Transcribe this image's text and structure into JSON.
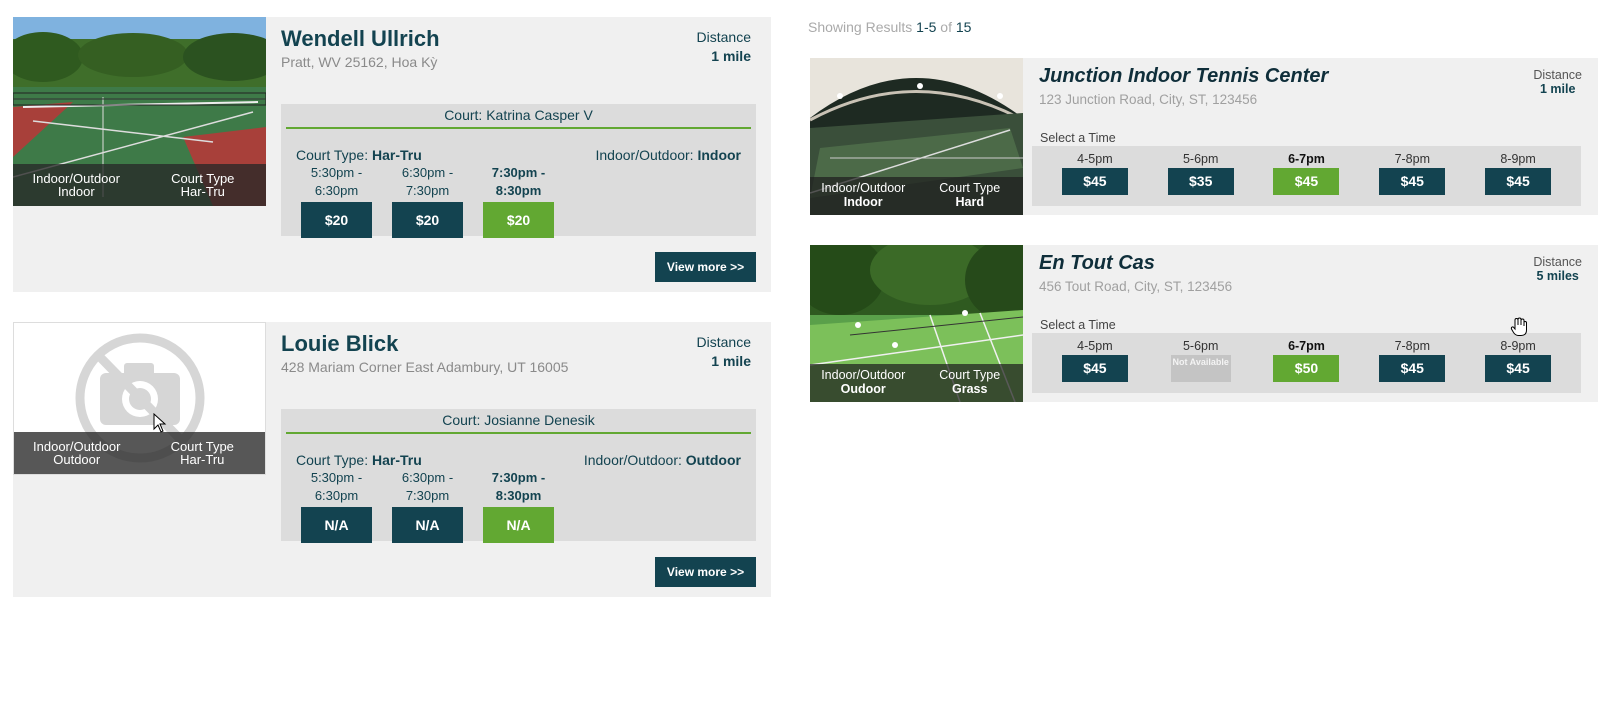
{
  "colors": {
    "primary": "#134350",
    "accent": "#62a832",
    "card_bg": "#f0f0f0",
    "panel_bg": "#dcdcdc"
  },
  "left_cards": [
    {
      "name": "Wendell Ullrich",
      "address": "Pratt, WV 25162, Hoa Kỳ",
      "distance_label": "Distance",
      "distance": "1 mile",
      "image": "tennis-court-photo",
      "overlay": {
        "io_label": "Indoor/Outdoor",
        "io_value": "Indoor",
        "type_label": "Court Type",
        "type_value": "Har-Tru"
      },
      "court_label": "Court:",
      "court_name": "Katrina Casper V",
      "court_type_label": "Court Type:",
      "court_type": "Har-Tru",
      "io_label": "Indoor/Outdoor:",
      "io_value": "Indoor",
      "slots": [
        {
          "time": "5:30pm - 6:30pm",
          "price": "$20",
          "selected": false
        },
        {
          "time": "6:30pm - 7:30pm",
          "price": "$20",
          "selected": false
        },
        {
          "time": "7:30pm - 8:30pm",
          "price": "$20",
          "selected": true
        }
      ],
      "view_more": "View more >>"
    },
    {
      "name": "Louie Blick",
      "address": "428 Mariam Corner East Adambury, UT 16005",
      "distance_label": "Distance",
      "distance": "1 mile",
      "image": "no-photo-icon",
      "overlay": {
        "io_label": "Indoor/Outdoor",
        "io_value": "Outdoor",
        "type_label": "Court Type",
        "type_value": "Har-Tru"
      },
      "court_label": "Court:",
      "court_name": "Josianne Denesik",
      "court_type_label": "Court Type:",
      "court_type": "Har-Tru",
      "io_label": "Indoor/Outdoor:",
      "io_value": "Outdoor",
      "slots": [
        {
          "time": "5:30pm - 6:30pm",
          "price": "N/A",
          "selected": false
        },
        {
          "time": "6:30pm - 7:30pm",
          "price": "N/A",
          "selected": false
        },
        {
          "time": "7:30pm - 8:30pm",
          "price": "N/A",
          "selected": true
        }
      ],
      "view_more": "View more >>"
    }
  ],
  "results": {
    "prefix": "Showing Results",
    "range": "1-5",
    "of": "of",
    "total": "15"
  },
  "right_cards": [
    {
      "name": "Junction Indoor Tennis Center",
      "address": "123 Junction Road, City, ST, 123456",
      "distance_label": "Distance",
      "distance": "1 mile",
      "overlay": {
        "io_label": "Indoor/Outdoor",
        "io_value": "Indoor",
        "type_label": "Court Type",
        "type_value": "Hard"
      },
      "select_label": "Select a Time",
      "slots": [
        {
          "time": "4-5pm",
          "price": "$45",
          "state": "normal"
        },
        {
          "time": "5-6pm",
          "price": "$35",
          "state": "normal"
        },
        {
          "time": "6-7pm",
          "price": "$45",
          "state": "selected"
        },
        {
          "time": "7-8pm",
          "price": "$45",
          "state": "normal"
        },
        {
          "time": "8-9pm",
          "price": "$45",
          "state": "normal"
        }
      ]
    },
    {
      "name": "En Tout Cas",
      "address": "456 Tout Road, City, ST, 123456",
      "distance_label": "Distance",
      "distance": "5 miles",
      "overlay": {
        "io_label": "Indoor/Outdoor",
        "io_value": "Oudoor",
        "type_label": "Court Type",
        "type_value": "Grass"
      },
      "select_label": "Select a Time",
      "slots": [
        {
          "time": "4-5pm",
          "price": "$45",
          "state": "normal"
        },
        {
          "time": "5-6pm",
          "price": "Not Available",
          "state": "na"
        },
        {
          "time": "6-7pm",
          "price": "$50",
          "state": "selected"
        },
        {
          "time": "7-8pm",
          "price": "$45",
          "state": "normal"
        },
        {
          "time": "8-9pm",
          "price": "$45",
          "state": "normal"
        }
      ]
    }
  ]
}
